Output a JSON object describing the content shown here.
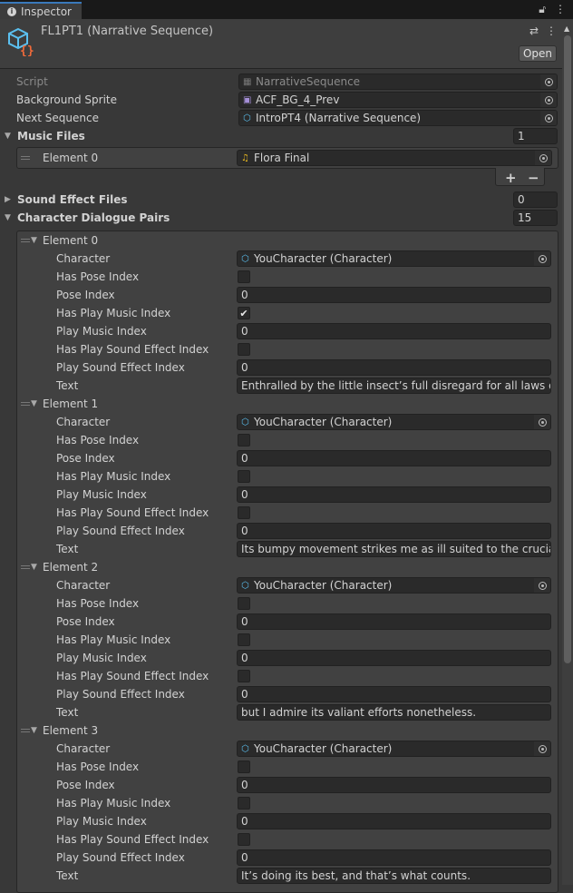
{
  "tab": {
    "label": "Inspector",
    "icons": [
      "info-icon",
      "lock-icon",
      "kebab-menu-icon"
    ]
  },
  "header": {
    "title": "FL1PT1 (Narrative Sequence)",
    "open_label": "Open",
    "icons": [
      "script-asset-icon",
      "preset-icon",
      "kebab-menu-icon"
    ]
  },
  "fields": {
    "script": {
      "label": "Script",
      "value": "NarrativeSequence"
    },
    "background_sprite": {
      "label": "Background Sprite",
      "value": "ACF_BG_4_Prev"
    },
    "next_sequence": {
      "label": "Next Sequence",
      "value": "IntroPT4 (Narrative Sequence)"
    }
  },
  "music_files": {
    "label": "Music Files",
    "count": "1",
    "expanded": true,
    "elements": [
      {
        "label": "Element 0",
        "value": "Flora Final"
      }
    ],
    "add_label": "+",
    "remove_label": "−"
  },
  "sound_effect_files": {
    "label": "Sound Effect Files",
    "count": "0",
    "expanded": false
  },
  "character_dialogue_pairs": {
    "label": "Character Dialogue Pairs",
    "count": "15",
    "expanded": true,
    "field_labels": {
      "character": "Character",
      "has_pose": "Has Pose Index",
      "pose": "Pose Index",
      "has_music": "Has Play Music Index",
      "music": "Play Music Index",
      "has_sfx": "Has Play Sound Effect Index",
      "sfx": "Play Sound Effect Index",
      "text": "Text"
    },
    "elements": [
      {
        "label": "Element 0",
        "character": "YouCharacter (Character)",
        "has_pose": false,
        "pose": "0",
        "has_music": true,
        "music": "0",
        "has_sfx": false,
        "sfx": "0",
        "text": "Enthralled by the little insect’s full disregard for all laws of avia"
      },
      {
        "label": "Element 1",
        "character": "YouCharacter (Character)",
        "has_pose": false,
        "pose": "0",
        "has_music": false,
        "music": "0",
        "has_sfx": false,
        "sfx": "0",
        "text": "Its bumpy movement strikes me as ill suited to the crucial eco"
      },
      {
        "label": "Element 2",
        "character": "YouCharacter (Character)",
        "has_pose": false,
        "pose": "0",
        "has_music": false,
        "music": "0",
        "has_sfx": false,
        "sfx": "0",
        "text": "but I admire its valiant efforts nonetheless."
      },
      {
        "label": "Element 3",
        "character": "YouCharacter (Character)",
        "has_pose": false,
        "pose": "0",
        "has_music": false,
        "music": "0",
        "has_sfx": false,
        "sfx": "0",
        "text": "It’s doing its best, and that’s what counts."
      }
    ]
  }
}
